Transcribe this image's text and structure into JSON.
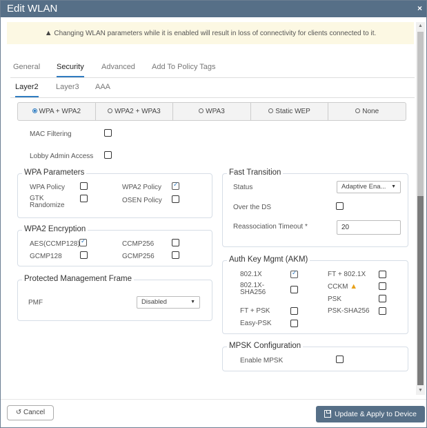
{
  "window": {
    "title": "Edit WLAN",
    "close_icon": "×"
  },
  "alert": {
    "icon": "▲",
    "text": "Changing WLAN parameters while it is enabled will result in loss of connectivity for clients connected to it."
  },
  "tabs": [
    {
      "label": "General",
      "active": false
    },
    {
      "label": "Security",
      "active": true
    },
    {
      "label": "Advanced",
      "active": false
    },
    {
      "label": "Add To Policy Tags",
      "active": false
    }
  ],
  "subtabs": [
    {
      "label": "Layer2",
      "active": true
    },
    {
      "label": "Layer3",
      "active": false
    },
    {
      "label": "AAA",
      "active": false
    }
  ],
  "security_modes": [
    {
      "label": "WPA + WPA2",
      "selected": true
    },
    {
      "label": "WPA2 + WPA3",
      "selected": false
    },
    {
      "label": "WPA3",
      "selected": false
    },
    {
      "label": "Static WEP",
      "selected": false
    },
    {
      "label": "None",
      "selected": false
    }
  ],
  "mac_filtering": {
    "label": "MAC Filtering",
    "checked": false
  },
  "lobby_admin": {
    "label": "Lobby Admin Access",
    "checked": false
  },
  "wpa_parameters": {
    "legend": "WPA Parameters",
    "items": [
      {
        "label": "WPA Policy",
        "checked": false
      },
      {
        "label": "WPA2 Policy",
        "checked": true
      },
      {
        "label": "GTK Randomize",
        "checked": false
      },
      {
        "label": "OSEN Policy",
        "checked": false
      }
    ]
  },
  "wpa2_encryption": {
    "legend": "WPA2 Encryption",
    "items": [
      {
        "label": "AES(CCMP128)",
        "checked": true
      },
      {
        "label": "CCMP256",
        "checked": false
      },
      {
        "label": "GCMP128",
        "checked": false
      },
      {
        "label": "GCMP256",
        "checked": false
      }
    ]
  },
  "pmf": {
    "legend": "Protected Management Frame",
    "label": "PMF",
    "value": "Disabled"
  },
  "fast_transition": {
    "legend": "Fast Transition",
    "status_label": "Status",
    "status_value": "Adaptive Ena...",
    "over_ds_label": "Over the DS",
    "over_ds_checked": false,
    "timeout_label": "Reassociation Timeout *",
    "timeout_value": "20"
  },
  "akm": {
    "legend": "Auth Key Mgmt (AKM)",
    "items": [
      {
        "label": "802.1X",
        "checked": true
      },
      {
        "label": "FT + 802.1X",
        "checked": false
      },
      {
        "label": "802.1X-SHA256",
        "checked": false
      },
      {
        "label": "CCKM",
        "checked": false,
        "warning": true
      },
      {
        "label": "PSK",
        "checked": false
      },
      {
        "label": "FT + PSK",
        "checked": false
      },
      {
        "label": "PSK-SHA256",
        "checked": false
      },
      {
        "label": "Easy-PSK",
        "checked": false
      }
    ]
  },
  "mpsk": {
    "legend": "MPSK Configuration",
    "label": "Enable MPSK",
    "checked": false
  },
  "footer": {
    "cancel_label": "Cancel",
    "cancel_icon": "↺",
    "update_label": "Update & Apply to Device"
  }
}
